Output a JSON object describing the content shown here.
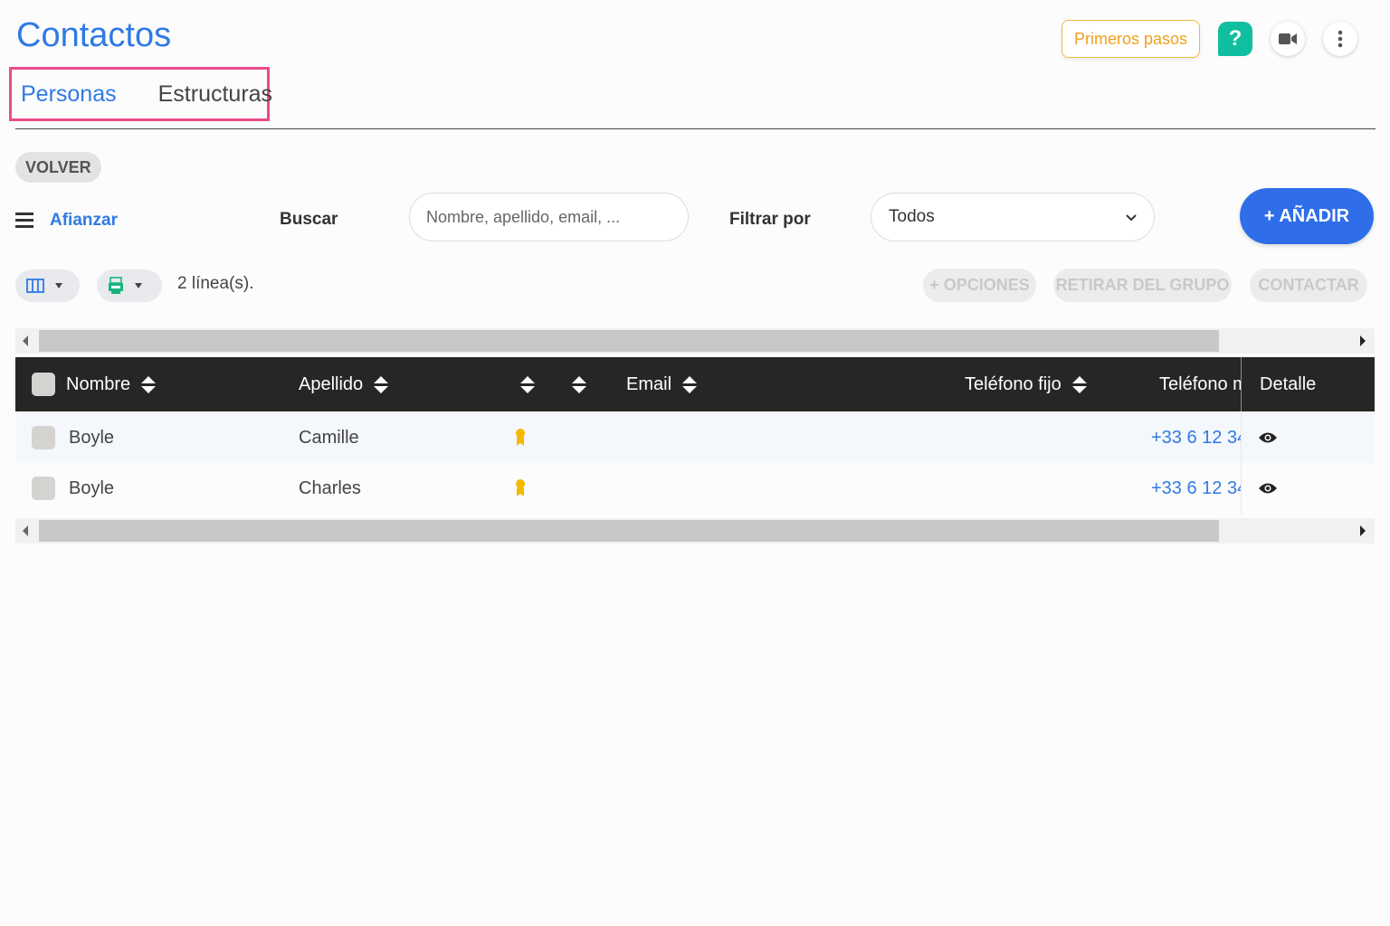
{
  "page": {
    "title": "Contactos"
  },
  "header": {
    "first_steps_label": "Primeros pasos",
    "help_label": "?"
  },
  "tabs": [
    {
      "label": "Personas",
      "active": true
    },
    {
      "label": "Estructuras",
      "active": false
    }
  ],
  "back_label": "VOLVER",
  "toolbar": {
    "afianzar_label": "Afianzar",
    "search_label": "Buscar",
    "search_placeholder": "Nombre, apellido, email, ...",
    "filter_label": "Filtrar por",
    "filter_value": "Todos",
    "add_label": "+ AÑADIR",
    "lines_count": "2 línea(s).",
    "options_label": "+ OPCIONES",
    "remove_group_label": "RETIRAR DEL GRUPO",
    "contact_label": "CONTACTAR"
  },
  "table": {
    "columns": [
      "Nombre",
      "Apellido",
      "",
      "",
      "Email",
      "Teléfono fijo",
      "Teléfono mó",
      "Detalle"
    ],
    "rows": [
      {
        "nombre": "Boyle",
        "apellido": "Camille",
        "email": "",
        "telefono_fijo": "",
        "telefono_movil": "+33 6 12 34 5"
      },
      {
        "nombre": "Boyle",
        "apellido": "Charles",
        "email": "",
        "telefono_fijo": "",
        "telefono_movil": "+33 6 12 34 5"
      }
    ]
  },
  "colors": {
    "accent": "#2f7ae5",
    "add_button": "#2f6ee8",
    "first_steps": "#f0a01c",
    "help": "#10bfa0",
    "tab_highlight": "#e94b8a",
    "header_bg": "#262626"
  },
  "icons": {
    "video": "video-camera-icon",
    "more": "more-vertical-icon",
    "menu": "hamburger-menu-icon",
    "columns": "columns-icon",
    "export": "spreadsheet-export-icon",
    "badge": "award-ribbon-icon",
    "detail": "eye-icon"
  }
}
